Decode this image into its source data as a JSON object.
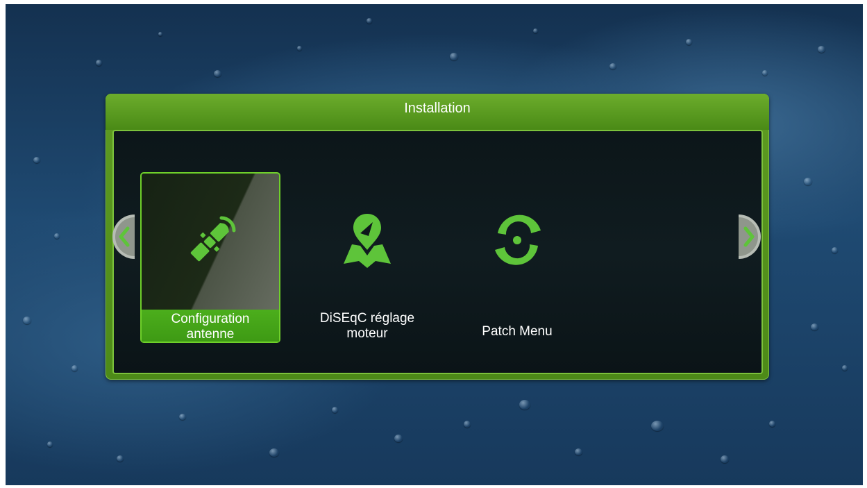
{
  "panel": {
    "title": "Installation"
  },
  "menu": {
    "items": [
      {
        "label_line1": "Configuration",
        "label_line2": "antenne",
        "icon": "satellite-icon",
        "selected": true
      },
      {
        "label_line1": "DiSEqC réglage",
        "label_line2": "moteur",
        "icon": "map-pin-icon",
        "selected": false
      },
      {
        "label_line1": "Patch Menu",
        "label_line2": "",
        "icon": "patch-icon",
        "selected": false
      }
    ]
  },
  "colors": {
    "accent_green": "#5e9b22",
    "icon_green": "#5ec43a",
    "selected_bar": "#4cae1c"
  }
}
